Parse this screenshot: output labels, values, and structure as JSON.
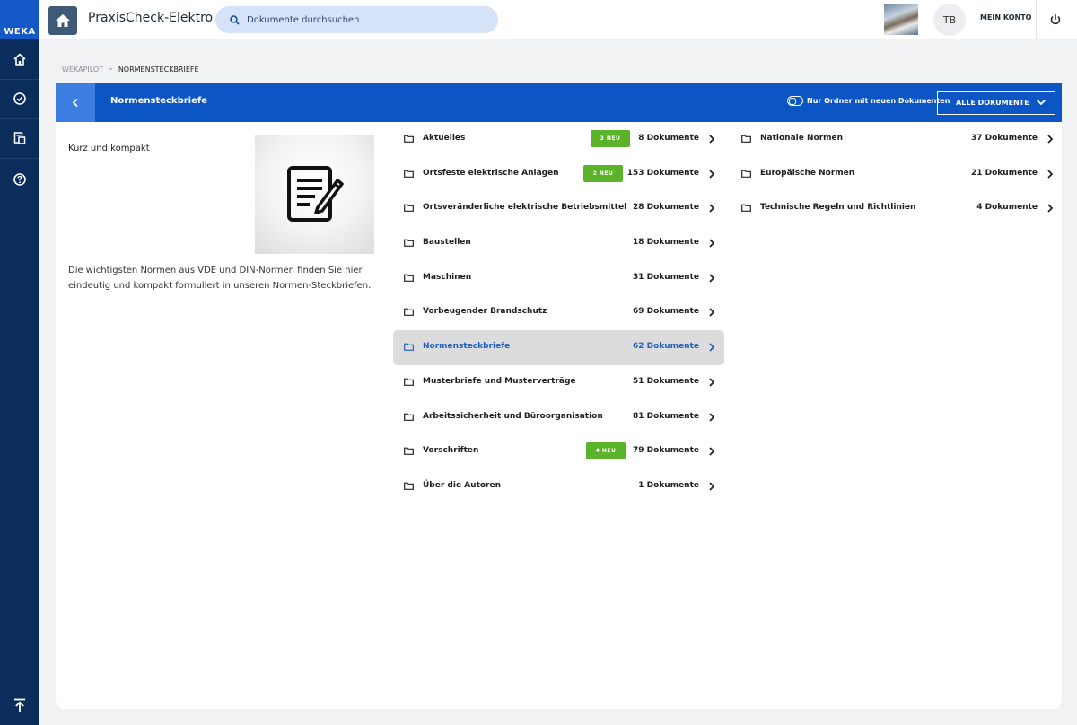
{
  "rail": {
    "logo": "WEKA",
    "icons": [
      "home-icon",
      "check-circle-icon",
      "documents-icon",
      "help-icon",
      "scroll-top-icon"
    ]
  },
  "header": {
    "app_title": "PraxisCheck-Elektro",
    "search_placeholder": "Dokumente durchsuchen",
    "avatar_initials": "TB",
    "account_label": "MEIN KONTO"
  },
  "breadcrumb": {
    "root": "WEKAPILOT",
    "current": "NORMENSTECKBRIEFE"
  },
  "toolbar": {
    "title": "Normensteckbriefe",
    "toggle_label": "Nur Ordner mit neuen Dokumenten",
    "filter_label": "ALLE DOKUMENTE"
  },
  "description": {
    "heading": "Kurz und kompakt",
    "body": "Die wichtigsten Normen aus VDE und DIN-Normen finden Sie hier eindeutig und kompakt formuliert in unseren Normen-Steckbriefen."
  },
  "folders_main": [
    {
      "name": "Aktuelles",
      "count": "8 Dokumente",
      "badge": "3 NEU"
    },
    {
      "name": "Ortsfeste elektrische Anlagen",
      "count": "153 Dokumente",
      "badge": "2 NEU"
    },
    {
      "name": "Ortsveränderliche elektrische Betriebsmittel",
      "count": "28 Dokumente",
      "badge": ""
    },
    {
      "name": "Baustellen",
      "count": "18 Dokumente",
      "badge": ""
    },
    {
      "name": "Maschinen",
      "count": "31 Dokumente",
      "badge": ""
    },
    {
      "name": "Vorbeugender Brandschutz",
      "count": "69 Dokumente",
      "badge": ""
    },
    {
      "name": "Normensteckbriefe",
      "count": "62 Dokumente",
      "badge": "",
      "active": true
    },
    {
      "name": "Musterbriefe und Musterverträge",
      "count": "51 Dokumente",
      "badge": ""
    },
    {
      "name": "Arbeitssicherheit und Büroorganisation",
      "count": "81 Dokumente",
      "badge": ""
    },
    {
      "name": "Vorschriften",
      "count": "79 Dokumente",
      "badge": "4 NEU"
    },
    {
      "name": "Über die Autoren",
      "count": "1 Dokumente",
      "badge": ""
    }
  ],
  "folders_sub": [
    {
      "name": "Nationale Normen",
      "count": "37 Dokumente"
    },
    {
      "name": "Europäische Normen",
      "count": "21 Dokumente"
    },
    {
      "name": "Technische Regeln und Richtlinien",
      "count": "4 Dokumente"
    }
  ],
  "colors": {
    "rail": "#0a2d5c",
    "brand_blue": "#0c55c4",
    "badge_green": "#5ab329",
    "active_text": "#1e5fbf"
  }
}
